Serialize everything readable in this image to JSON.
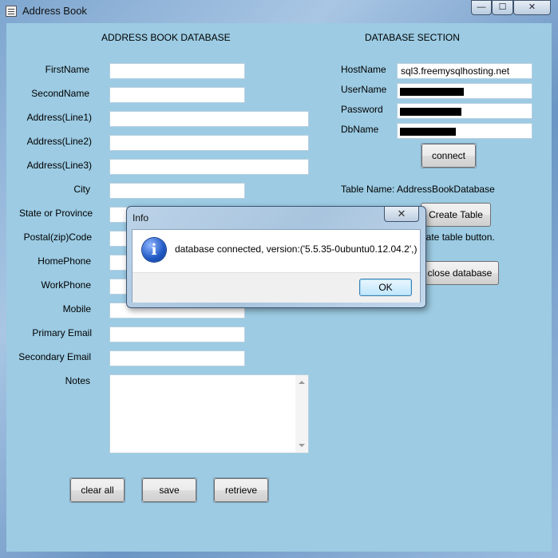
{
  "window": {
    "title": "Address Book",
    "caption_buttons": {
      "minimize": "—",
      "maximize": "☐",
      "close": "✕"
    }
  },
  "left": {
    "heading": "ADDRESS BOOK DATABASE",
    "fields": [
      {
        "label": "FirstName",
        "value": ""
      },
      {
        "label": "SecondName",
        "value": ""
      },
      {
        "label": "Address(Line1)",
        "value": ""
      },
      {
        "label": "Address(Line2)",
        "value": ""
      },
      {
        "label": "Address(Line3)",
        "value": ""
      },
      {
        "label": "City",
        "value": ""
      },
      {
        "label": "State or Province",
        "value": ""
      },
      {
        "label": "Postal(zip)Code",
        "value": ""
      },
      {
        "label": "HomePhone",
        "value": ""
      },
      {
        "label": "WorkPhone",
        "value": ""
      },
      {
        "label": "Mobile",
        "value": ""
      },
      {
        "label": "Primary Email",
        "value": ""
      },
      {
        "label": "Secondary Email",
        "value": ""
      }
    ],
    "notes_label": "Notes",
    "buttons": {
      "clear": "clear all",
      "save": "save",
      "retrieve": "retrieve"
    }
  },
  "right": {
    "heading": "DATABASE SECTION",
    "hostname_label": "HostName",
    "hostname_value": "sql3.freemysqlhosting.net",
    "username_label": "UserName",
    "password_label": "Password",
    "dbname_label": "DbName",
    "connect_button": "connect",
    "table_name": "Table Name: AddressBookDatabase",
    "create_table_button": "Create Table",
    "create_hint": "eate table button.",
    "close_database_button": "close database"
  },
  "dialog": {
    "title": "Info",
    "close": "✕",
    "icon": "info-icon",
    "message": "database connected, version:('5.5.35-0ubuntu0.12.04.2',)",
    "ok_button": "OK"
  }
}
